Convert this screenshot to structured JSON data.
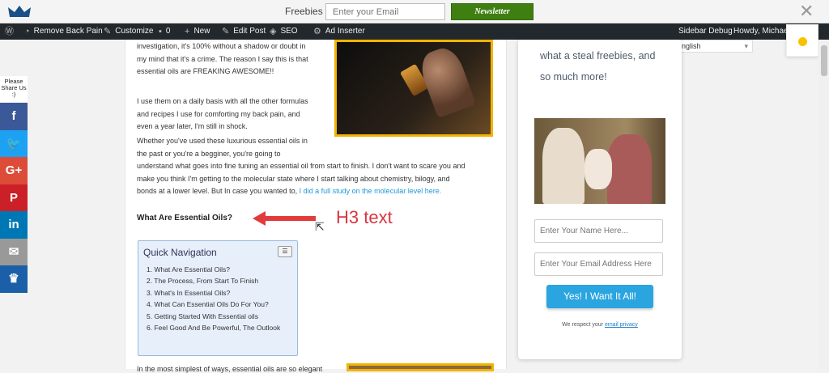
{
  "topbar": {
    "label": "Freebies",
    "email_placeholder": "Enter your Email",
    "button_label": "Newsletter",
    "close_glyph": "✕"
  },
  "adminbar": {
    "items": [
      {
        "icon": "wordpress-icon",
        "label": ""
      },
      {
        "icon": "dashboard-icon",
        "label": "Remove Back Pain"
      },
      {
        "icon": "brush-icon",
        "label": "Customize"
      },
      {
        "icon": "comment-icon",
        "label": "0"
      },
      {
        "icon": "plus-icon",
        "label": "New"
      },
      {
        "icon": "pencil-icon",
        "label": "Edit Post"
      },
      {
        "icon": "seo-icon",
        "label": "SEO"
      },
      {
        "icon": "gear-icon",
        "label": "Ad Inserter"
      }
    ],
    "right_items": [
      "Sidebar Debug",
      "Howdy, Michael"
    ]
  },
  "language": {
    "selected": "English"
  },
  "share": {
    "title": "Please Share Us :)",
    "buttons": [
      {
        "icon": "facebook-icon",
        "glyph": "f",
        "color": "#3b5998"
      },
      {
        "icon": "twitter-icon",
        "glyph": "🐦",
        "color": "#1da1f2"
      },
      {
        "icon": "google-plus-icon",
        "glyph": "G+",
        "color": "#dd4b39"
      },
      {
        "icon": "pinterest-icon",
        "glyph": "P",
        "color": "#cb2027"
      },
      {
        "icon": "linkedin-icon",
        "glyph": "in",
        "color": "#0077b5"
      },
      {
        "icon": "email-icon",
        "glyph": "✉",
        "color": "#999999"
      },
      {
        "icon": "crown-icon",
        "glyph": "♛",
        "color": "#1b5fa8"
      }
    ]
  },
  "article": {
    "p1_lines": [
      "investigation, it's 100% without a shadow or doubt in",
      "my mind that it's a crime. The reason I say this is that",
      "essential oils are FREAKING AWESOME!!"
    ],
    "p2_lines": [
      "I use them on a daily basis with all the other formulas",
      "and recipes I use for comforting my back pain, and",
      "even a year later, I'm still in shock."
    ],
    "p3_lines": [
      "Whether you've used these luxurious essential oils in",
      "the past or you're a begginer, you're going to",
      "understand what goes into fine tuning an essential oil from start to finish. I don't want to scare you and",
      "make you think I'm getting to the molecular state where I start talking about chemistry, bilogy, and",
      "bonds at a lower level. But In case you wanted to, "
    ],
    "p3_link": "I did a full study on the molecular level here.",
    "h3": "What Are Essential Oils?",
    "annotation": "H3 text",
    "bottom_text": "In the most simplest of ways, essential oils are so elegant"
  },
  "quick_nav": {
    "title": "Quick Navigation",
    "toggle": "☰",
    "items": [
      "1. What Are Essential Oils?",
      "2. The Process, From Start To Finish",
      "3. What's In Essential Oils?",
      "4. What Can Essential Oils Do For You?",
      "5. Getting Started With Essential oils",
      "6. Feel Good And Be Powerful, The Outlook"
    ]
  },
  "sidebar": {
    "text_lines": [
      "what a steal freebies, and",
      "so much more!"
    ],
    "name_placeholder": "Enter Your Name Here...",
    "email_placeholder": "Enter Your Email Address Here",
    "cta": "Yes! I Want It All!",
    "privacy_prefix": "We respect your ",
    "privacy_link": "email privacy"
  }
}
